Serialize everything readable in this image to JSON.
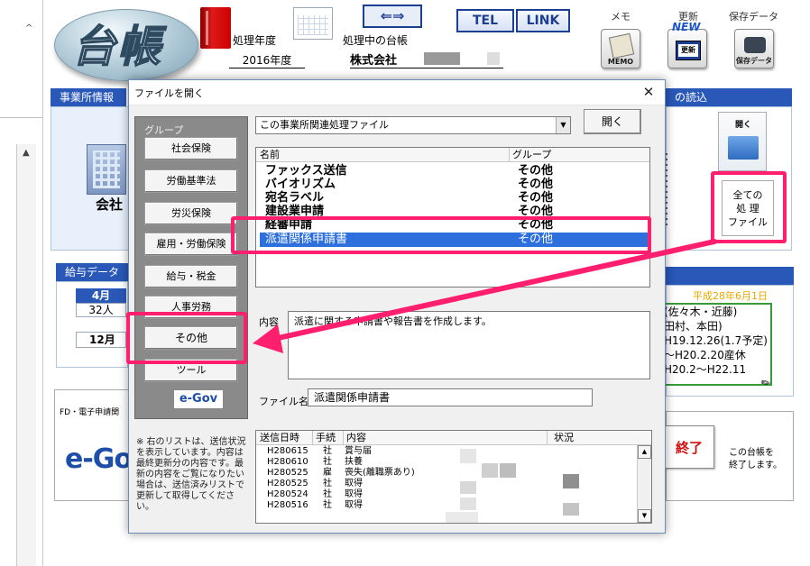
{
  "app": {
    "logo": "台帳",
    "year_caption": "処理年度",
    "book_caption": "処理中の台帳",
    "year_value": "2016年度",
    "company_value": "株式会社",
    "tel_btn": "TEL",
    "link_btn": "LINK",
    "memo_label": "メモ",
    "memo_icon_caption": "MEMO",
    "update_label": "更新",
    "update_badge": "NEW",
    "update_icon_text": "更新",
    "save_label": "保存データ",
    "save_icon_caption": "保存データ",
    "section_office": "事業所情報",
    "section_read": "の読込",
    "section_salary": "給与データ",
    "company_icon_label": "会社",
    "month_april": "4月",
    "month_april_count": "32人",
    "month_december": "12月",
    "open_small": "開く",
    "all_files_button": "全ての\n処 理\nファイル",
    "date_note": "平成28年6月1日",
    "info_lines": [
      "(佐々木・近藤)",
      "田村、本田)",
      "H19.12.26(1.7予定)",
      "〜H20.2.20産休",
      "H20.2〜H22.11"
    ],
    "fd_label": "FD・電子申請関",
    "egov_big": "e-Gov",
    "exit_button": "終了",
    "exit_desc": "この台帳を\n終了します。"
  },
  "dialog": {
    "title": "ファイルを開く",
    "close": "✕",
    "group_label": "グループ",
    "groups": [
      "社会保険",
      "労働基準法",
      "労災保険",
      "雇用・労働保険",
      "給与・税金",
      "人事労務",
      "その他",
      "ツール"
    ],
    "egov_badge": "e-Gov",
    "combo_value": "この事業所関連処理ファイル",
    "open_button": "開く",
    "columns": {
      "name": "名前",
      "group": "グループ"
    },
    "files": [
      {
        "name": "ファックス送信",
        "group": "その他"
      },
      {
        "name": "バイオリズム",
        "group": "その他"
      },
      {
        "name": "宛名ラベル",
        "group": "その他"
      },
      {
        "name": "建設業申請",
        "group": "その他"
      },
      {
        "name": "経審申請",
        "group": "その他"
      },
      {
        "name": "派遣関係申請書",
        "group": "その他"
      }
    ],
    "desc_label": "内容",
    "desc_value": "派遣に関する申請書や報告書を作成します。",
    "filename_label": "ファイル名",
    "filename_value": "派遣関係申請書",
    "note": "※ 右のリストは、送信状況を表示しています。内容は最終更新分の内容です。最新の内容をご覧になりたい場合は、送信済みリストで更新して取得してください。",
    "history_columns": {
      "date": "送信日時",
      "proc": "手続",
      "content": "内容",
      "status": "状況"
    },
    "history": [
      {
        "date": "H280615",
        "proc": "社",
        "content": "賞与届"
      },
      {
        "date": "H280610",
        "proc": "社",
        "content": "扶養"
      },
      {
        "date": "H280525",
        "proc": "雇",
        "content": "喪失(離職票あり)"
      },
      {
        "date": "H280525",
        "proc": "社",
        "content": "取得"
      },
      {
        "date": "H280524",
        "proc": "社",
        "content": "取得"
      },
      {
        "date": "H280516",
        "proc": "社",
        "content": "取得"
      }
    ]
  }
}
